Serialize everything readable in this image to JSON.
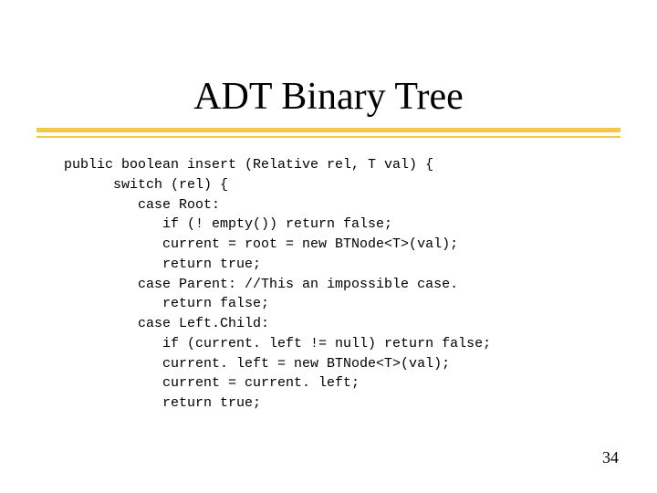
{
  "title": "ADT Binary Tree",
  "code": "public boolean insert (Relative rel, T val) {\n      switch (rel) {\n         case Root:\n            if (! empty()) return false;\n            current = root = new BTNode<T>(val);\n            return true;\n         case Parent: //This an impossible case.\n            return false;\n         case Left.Child:\n            if (current. left != null) return false;\n            current. left = new BTNode<T>(val);\n            current = current. left;\n            return true;",
  "pageNumber": "34"
}
